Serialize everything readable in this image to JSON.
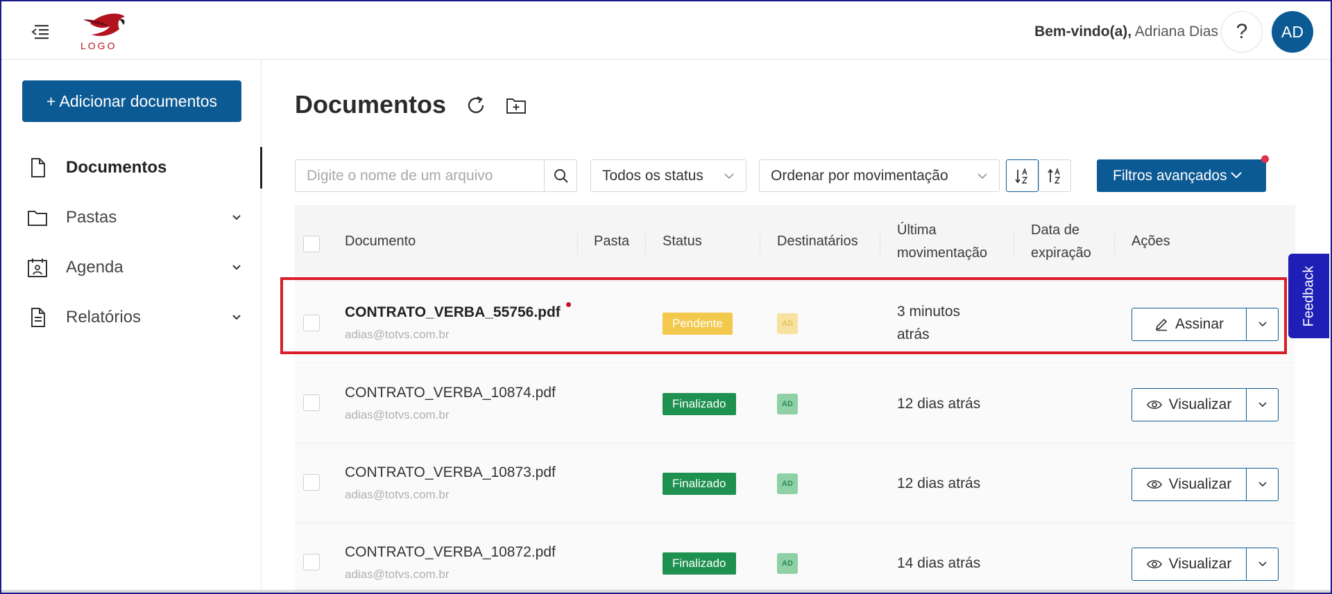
{
  "header": {
    "logo_text": "LOGO",
    "welcome_label": "Bem-vindo(a),",
    "user_name": "Adriana Dias",
    "help_label": "?",
    "avatar_initials": "AD"
  },
  "sidebar": {
    "add_button_label": "+ Adicionar documentos",
    "items": [
      {
        "label": "Documentos",
        "icon": "document-icon",
        "active": true
      },
      {
        "label": "Pastas",
        "icon": "folder-icon"
      },
      {
        "label": "Agenda",
        "icon": "calendar-icon"
      },
      {
        "label": "Relatórios",
        "icon": "report-icon"
      }
    ]
  },
  "main": {
    "title": "Documentos",
    "search": {
      "placeholder": "Digite o nome de um arquivo",
      "value": ""
    },
    "status_filter": "Todos os status",
    "order_filter": "Ordenar por movimentação",
    "advanced_filters_label": "Filtros avançados"
  },
  "table": {
    "headers": {
      "document": "Documento",
      "folder": "Pasta",
      "status": "Status",
      "recipients": "Destinatários",
      "last_move_line1": "Última",
      "last_move_line2": "movimentação",
      "expiration_line1": "Data de",
      "expiration_line2": "expiração",
      "actions": "Ações"
    },
    "rows": [
      {
        "name": "CONTRATO_VERBA_55756.pdf",
        "email": "adias@totvs.com.br",
        "status": "Pendente",
        "status_color": "#f2c94c",
        "recipient": "AD",
        "moved_line1": "3 minutos",
        "moved_line2": "atrás",
        "action": "Assinar",
        "action_icon": "pen-icon",
        "unread": true
      },
      {
        "name": "CONTRATO_VERBA_10874.pdf",
        "email": "adias@totvs.com.br",
        "status": "Finalizado",
        "status_color": "#1e9150",
        "recipient": "AD",
        "moved_line1": "12 dias atrás",
        "moved_line2": "",
        "action": "Visualizar",
        "action_icon": "eye-icon"
      },
      {
        "name": "CONTRATO_VERBA_10873.pdf",
        "email": "adias@totvs.com.br",
        "status": "Finalizado",
        "status_color": "#1e9150",
        "recipient": "AD",
        "moved_line1": "12 dias atrás",
        "moved_line2": "",
        "action": "Visualizar",
        "action_icon": "eye-icon"
      },
      {
        "name": "CONTRATO_VERBA_10872.pdf",
        "email": "adias@totvs.com.br",
        "status": "Finalizado",
        "status_color": "#1e9150",
        "recipient": "AD",
        "moved_line1": "14 dias atrás",
        "moved_line2": "",
        "action": "Visualizar",
        "action_icon": "eye-icon"
      }
    ]
  },
  "feedback_label": "Feedback",
  "colors": {
    "primary": "#0c5a94",
    "highlight": "#d91e2a",
    "feedback": "#1f1fb8"
  }
}
